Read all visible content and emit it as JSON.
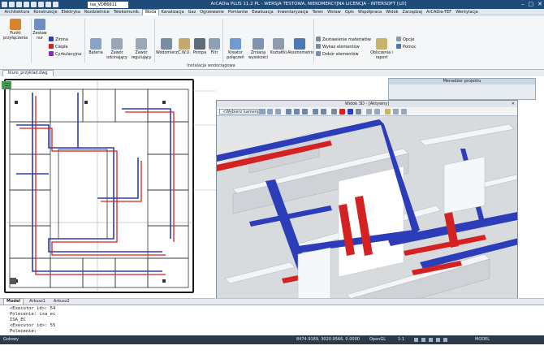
{
  "window": {
    "title": "ArCADia PLUS 11.2 PL - WERSJA TESTOWA, NIEKOMERCYJNA LICENCJA - INTERSOFT [LD]",
    "file_box": "isa_VDB6611",
    "controls": [
      "–",
      "□",
      "✕"
    ]
  },
  "menu_tabs": [
    "Architektura",
    "Konstrukcje",
    "Elektryka",
    "Rozdzielnice",
    "Telekomunik.",
    "Woda",
    "Kanalizacja",
    "Gaz",
    "Ogrzewanie",
    "Pomiarów",
    "Ewakuacja",
    "Inwentaryzacja",
    "Teren",
    "Wstaw",
    "Opis",
    "Współpraca",
    "Widok",
    "Zarządzaj",
    "ArCADia-TEF",
    "Wentylacja"
  ],
  "active_tab": "Woda",
  "ribbon": {
    "punkt": "Punkt przyłączenia",
    "zestaw": "Zestaw nur",
    "zimna": "Zimna",
    "ciepla": "Ciepła",
    "cyrkulacyjna": "Cyrkulacyjna",
    "bateria": "Bateria",
    "zawor_odc": "Zawór odcinający",
    "zawor_reg": "Zawór regulujący",
    "wodomierz": "Wodomierz",
    "cwu": "C.W.U.",
    "pompa": "Pompa",
    "filtr": "Filtr",
    "kreator": "Kreator połączeń",
    "zmiana": "Zmiana wysokości",
    "ksztaltki": "Kształtki",
    "aksonometria": "Aksonometria",
    "zestawienie": "Zestawienie materiałów",
    "wykaz": "Wykaz elementów",
    "dobor": "Dobór elementów",
    "obliczenia": "Obliczenia i raport",
    "opcje": "Opcje",
    "pomoc": "Pomoc",
    "group_label": "Instalacja wodociągowa"
  },
  "document_tab": "biuro_przyklad.dwg",
  "manager": {
    "title": "Menadżer projektu"
  },
  "view3d": {
    "title": "Widok 3D - [Aktywny]",
    "camera": "<Wybierz kamerę>"
  },
  "layout_tabs": [
    "Model",
    "Arkusz1",
    "Arkusz2"
  ],
  "command_lines": [
    "<Executor id>: 54",
    "Polecenie: isa_ec",
    "ISA_EC",
    "<Executor id>: 55",
    "Polecenie:"
  ],
  "status": {
    "left": "Gotowy",
    "coords": "8474.9189, 3020.9566, 0.0000",
    "opengl": "OpenGL",
    "scale": "1:1",
    "model": "MODEL"
  },
  "colors": {
    "title_bar": "#1e4b7a",
    "status_bar": "#2b3a4a",
    "pipe_cold": "#2b3db8",
    "pipe_hot": "#d42222"
  }
}
